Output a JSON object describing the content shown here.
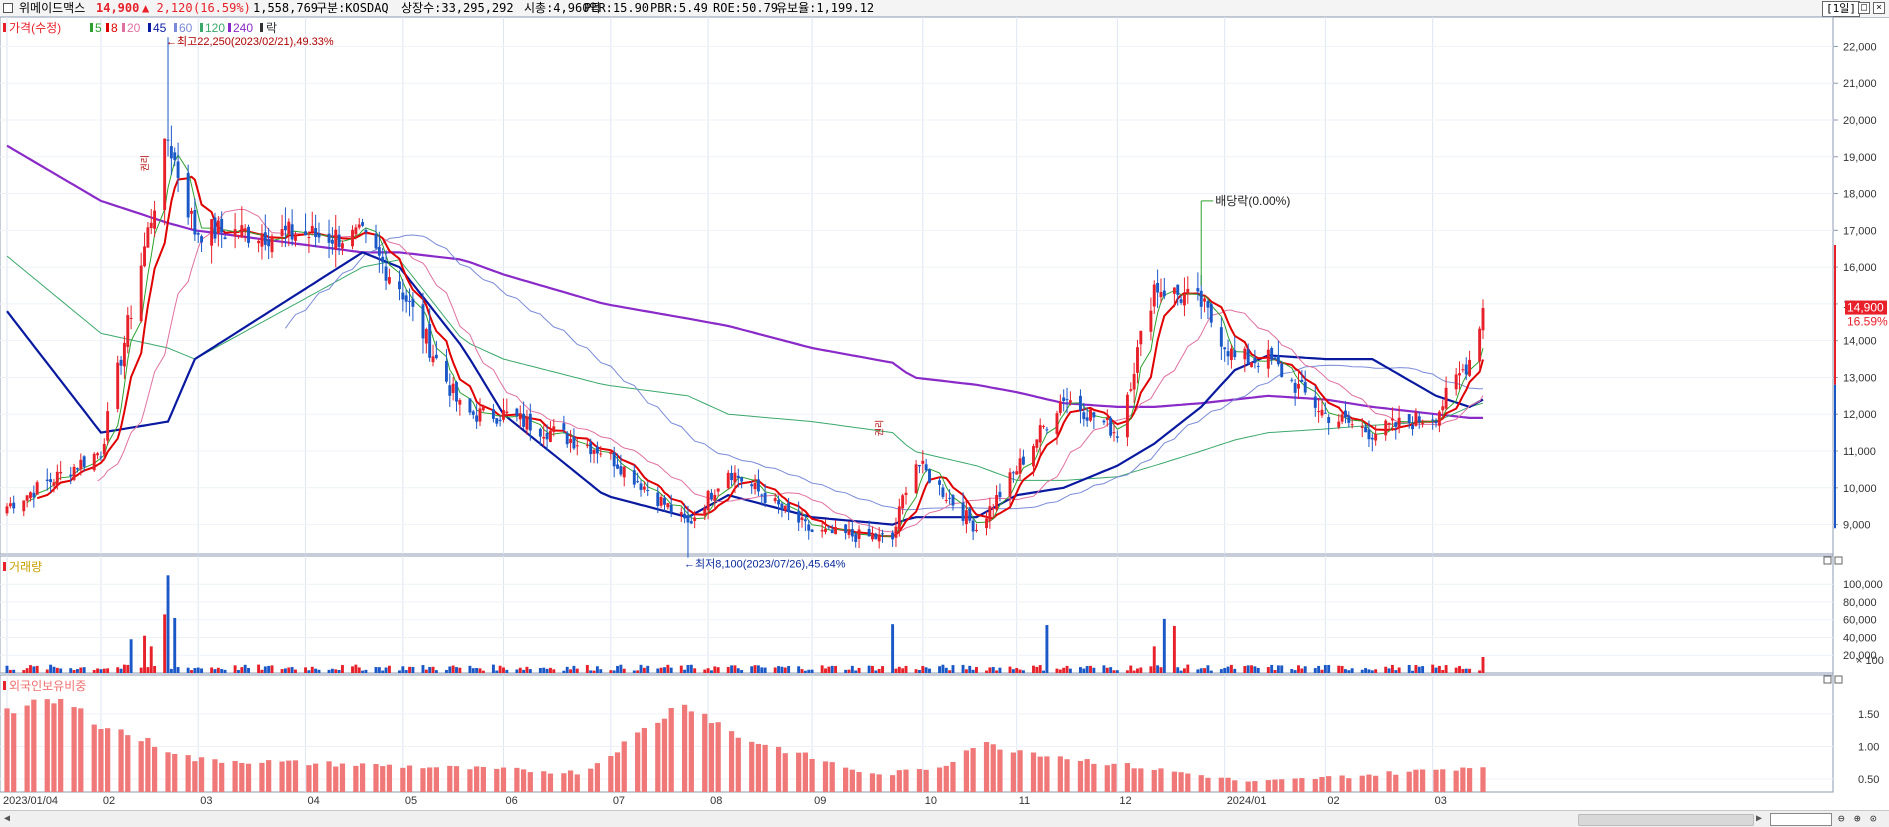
{
  "header": {
    "name": "위메이드맥스",
    "price": "14,900",
    "change": "▲ 2,120",
    "change_pct": "(16.59%)",
    "volume": "1,558,769",
    "market": "구분:KOSDAQ",
    "shares": "상장수:33,295,292",
    "mcap": "시총:4,960억",
    "per": "PER:15.90",
    "pbr": "PBR:5.49",
    "roe": "ROE:50.79",
    "reserve": "유보율:1,199.12",
    "period": "[1일]",
    "colors": {
      "up": "#e8202a",
      "down": "#1a58c8"
    }
  },
  "legend": {
    "price_label": "가격(수정)",
    "ma5": "5",
    "ma8": "8",
    "ma20": "20",
    "ma45": "45",
    "ma60": "60",
    "ma120": "120",
    "ma240": "240",
    "event": "락",
    "colors": {
      "ma5": "#2ca02c",
      "ma8": "#e00000",
      "ma20": "#e070a0",
      "ma45": "#0a1aa0",
      "ma60": "#7a8ad8",
      "ma120": "#3aa86a",
      "ma240": "#8a2ac8"
    }
  },
  "volume_panel": {
    "label": "거래량"
  },
  "foreign_panel": {
    "label": "외국인보유비중"
  },
  "chart_data": [
    {
      "type": "candlestick",
      "title": "위메이드맥스",
      "x": [
        "2023/01/04",
        "02",
        "03",
        "04",
        "05",
        "06",
        "07",
        "08",
        "09",
        "10",
        "11",
        "12",
        "2024/01",
        "02",
        "03"
      ],
      "y_ticks": [
        "22,000",
        "21,000",
        "20,000",
        "19,000",
        "18,000",
        "17,000",
        "16,000",
        "15,000",
        "14,000",
        "13,000",
        "12,000",
        "11,000",
        "10,000",
        "9,000"
      ],
      "ylim": [
        8200,
        22800
      ],
      "last_price": "14,900",
      "last_pct": "16.59%",
      "annotations": {
        "high": "←최고22,250(2023/02/21),49.33%",
        "low": "←최저8,100(2023/07/26),45.64%",
        "dividend": "배당락(0.00%)",
        "rights1": "권리",
        "rights2": "권리"
      },
      "anchors": {
        "x": [
          "2023/01/04",
          "2023/02/01",
          "2023/02/21",
          "2023/03/01",
          "2023/04/20",
          "2023/05/01",
          "2023/05/20",
          "2023/06/01",
          "2023/07/01",
          "2023/07/26",
          "2023/08/07",
          "2023/09/01",
          "2023/09/25",
          "2023/10/01",
          "2023/10/20",
          "2023/11/01",
          "2023/11/15",
          "2023/12/01",
          "2023/12/12",
          "2023/12/26",
          "2024/01/05",
          "2024/01/15",
          "2024/02/01",
          "2024/02/15",
          "2024/03/05",
          "2024/03/15",
          "2024/03/19"
        ],
        "y": [
          9500,
          11000,
          19500,
          17000,
          16800,
          15500,
          12000,
          12000,
          11000,
          9000,
          10500,
          8800,
          8600,
          10800,
          8900,
          10500,
          12500,
          11500,
          15500,
          15000,
          13500,
          13500,
          12000,
          11500,
          12000,
          13500,
          14900
        ]
      },
      "ma_anchors": {
        "ma45": [
          14800,
          11500,
          11800,
          13500,
          16400,
          16000,
          13800,
          12000,
          9800,
          9200,
          9800,
          9200,
          9000,
          9200,
          9200,
          9800,
          10000,
          10600,
          11200,
          12200,
          13200,
          13600,
          13500,
          13500,
          12500,
          12200,
          12400
        ],
        "ma120": [
          16300,
          14200,
          13800,
          13500,
          16000,
          16200,
          14000,
          13500,
          12800,
          12500,
          12000,
          11800,
          11500,
          11000,
          10600,
          10200,
          10200,
          10300,
          10600,
          11000,
          11300,
          11500,
          11600,
          11700,
          11800,
          12200,
          12300
        ],
        "ma240": [
          19300,
          17800,
          17200,
          17000,
          16400,
          16400,
          16200,
          15800,
          15000,
          14600,
          14400,
          13800,
          13400,
          13000,
          12800,
          12600,
          12300,
          12200,
          12200,
          12300,
          12400,
          12500,
          12400,
          12200,
          12000,
          11900,
          11900
        ]
      }
    },
    {
      "type": "bar",
      "title": "거래량",
      "y_ticks": [
        "100,000",
        "80,000",
        "60,000",
        "40,000",
        "20,000"
      ],
      "y_unit": "× 100",
      "ylim": [
        0,
        125000
      ],
      "spikes": {
        "x": [
          "2023/02/10",
          "2023/02/14",
          "2023/02/16",
          "2023/02/20",
          "2023/02/21",
          "2023/02/23",
          "2023/09/25",
          "2023/11/10",
          "2023/12/12",
          "2023/12/15",
          "2023/12/18",
          "2024/03/19"
        ],
        "y": [
          38000,
          42000,
          30000,
          66000,
          110000,
          62000,
          55000,
          54000,
          30000,
          61000,
          53000,
          18000
        ]
      }
    },
    {
      "type": "bar",
      "title": "외국인보유비중",
      "y_ticks": [
        "1.50",
        "1.00",
        "0.50"
      ],
      "ylim": [
        0.3,
        2.1
      ],
      "anchors": {
        "x": [
          "2023/01/04",
          "2023/01/20",
          "2023/02/01",
          "2023/03/01",
          "2023/05/01",
          "2023/06/25",
          "2023/07/25",
          "2023/08/10",
          "2023/09/20",
          "2023/10/10",
          "2023/10/20",
          "2023/11/20",
          "2023/12/20",
          "2024/01/10",
          "2024/02/10",
          "2024/03/19"
        ],
        "y": [
          1.55,
          1.7,
          1.35,
          0.8,
          0.7,
          0.6,
          1.7,
          1.15,
          0.55,
          0.7,
          1.05,
          0.8,
          0.6,
          0.45,
          0.55,
          0.7
        ]
      }
    }
  ]
}
